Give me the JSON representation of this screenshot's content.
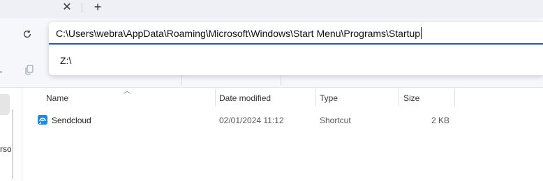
{
  "tabs": {
    "close_glyph": "✕",
    "new_tab_glyph": "+"
  },
  "address": {
    "path": "C:\\Users\\webra\\AppData\\Roaming\\Microsoft\\Windows\\Start Menu\\Programs\\Startup",
    "suggestions": [
      {
        "label": "Z:\\"
      }
    ]
  },
  "nav": {
    "partial_item_text": "rsoi"
  },
  "columns": [
    {
      "label": "Name"
    },
    {
      "label": "Date modified"
    },
    {
      "label": "Type"
    },
    {
      "label": "Size"
    }
  ],
  "files": [
    {
      "name": "Sendcloud",
      "date_modified": "02/01/2024 11:12",
      "type": "Shortcut",
      "size": "2 KB",
      "icon": "sendcloud-app-icon"
    }
  ],
  "colors": {
    "accent": "#0f5fc2",
    "chrome_bg": "#f6f7fb",
    "tab_bg": "#eef0f5"
  }
}
